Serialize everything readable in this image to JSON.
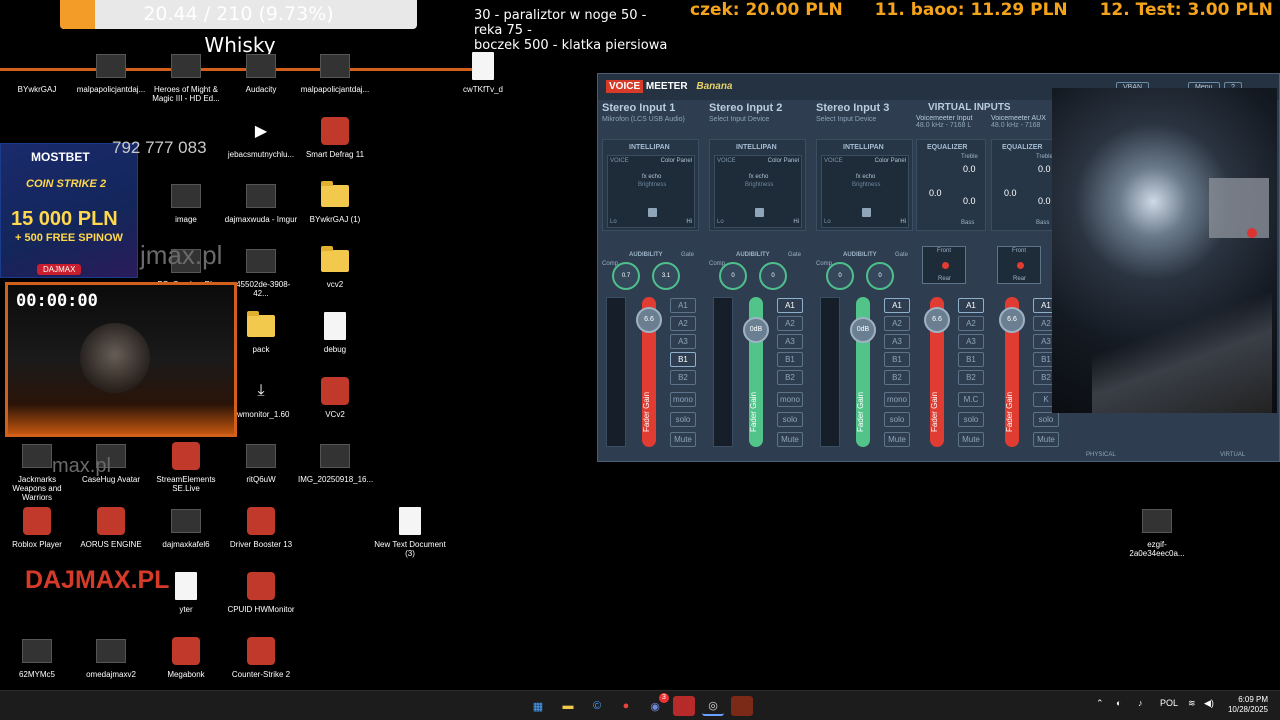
{
  "overlay": {
    "goal_text": "20.44 / 210 (9.73%)",
    "goal_fraction": 0.0973,
    "goal_name": "Whisky",
    "price_list": [
      "30 - paraliztor w noge 50 - reka 75 -",
      "boczek 500 - klatka piersiowa"
    ],
    "ticker": [
      {
        "rank": "",
        "name": "czek:",
        "amount": "20.00 PLN"
      },
      {
        "rank": "11.",
        "name": "baoo:",
        "amount": "11.29 PLN"
      },
      {
        "rank": "12.",
        "name": "Test:",
        "amount": "3.00 PLN"
      }
    ],
    "accent_color": "#f39c28",
    "line_color": "#d2601a"
  },
  "desktop": {
    "icons": [
      {
        "label": "BYwkrGAJ",
        "kind": "blank"
      },
      {
        "label": "malpapolicjantdaj...",
        "kind": "thumb"
      },
      {
        "label": "Heroes of Might & Magic III - HD Ed...",
        "kind": "thumb"
      },
      {
        "label": "Audacity",
        "kind": "thumb"
      },
      {
        "label": "malpapolicjantdaj...",
        "kind": "thumb"
      },
      {
        "label": "cwTKfTv_d",
        "kind": "doc"
      },
      {
        "label": "jebacsmutnychlu...",
        "kind": "media"
      },
      {
        "label": "Smart Defrag 11",
        "kind": "app"
      },
      {
        "label": "image",
        "kind": "thumb"
      },
      {
        "label": "dajmaxwuda - Imgur",
        "kind": "thumb"
      },
      {
        "label": "BYwkrGAJ (1)",
        "kind": "folder"
      },
      {
        "label": "BS_Overlay_PL",
        "kind": "thumb"
      },
      {
        "label": "a45502de-3908-42...",
        "kind": "thumb"
      },
      {
        "label": "vcv2",
        "kind": "folder"
      },
      {
        "label": "pack",
        "kind": "folder"
      },
      {
        "label": "debug",
        "kind": "doc"
      },
      {
        "label": "hwmonitor_1.60",
        "kind": "download"
      },
      {
        "label": "VCv2",
        "kind": "app"
      },
      {
        "label": "Jackmarks Weapons and Warriors",
        "kind": "thumb"
      },
      {
        "label": "CaseHug Avatar",
        "kind": "thumb"
      },
      {
        "label": "StreamElements SE.Live",
        "kind": "app"
      },
      {
        "label": "ritQ6uW",
        "kind": "thumb"
      },
      {
        "label": "IMG_20250918_16...",
        "kind": "thumb"
      },
      {
        "label": "Roblox Player",
        "kind": "app"
      },
      {
        "label": "AORUS ENGINE",
        "kind": "app"
      },
      {
        "label": "dajmaxkafel6",
        "kind": "thumb"
      },
      {
        "label": "Driver Booster 13",
        "kind": "app"
      },
      {
        "label": "New Text Document (3)",
        "kind": "doc"
      },
      {
        "label": "ezgif-2a0e34eec0a...",
        "kind": "thumb"
      },
      {
        "label": "yter",
        "kind": "doc"
      },
      {
        "label": "CPUID HWMonitor",
        "kind": "app"
      },
      {
        "label": "62MYMc5",
        "kind": "thumb"
      },
      {
        "label": "omedajmaxv2",
        "kind": "thumb"
      },
      {
        "label": "Megabonk",
        "kind": "app"
      },
      {
        "label": "Counter-Strike 2",
        "kind": "app"
      }
    ],
    "watermark_big": "DAJMAX.PL",
    "watermark_small_1": "jmax.pl",
    "watermark_small_2": "max.pl"
  },
  "ad": {
    "brand": "MOSTBET",
    "game": "COIN STRIKE 2",
    "amount": "15 000 PLN",
    "bonus": "+ 500 FREE SPINOW",
    "code": "DAJMAX",
    "phone": "792 777 083"
  },
  "webcam": {
    "timer": "00:00:00"
  },
  "voicemeeter": {
    "logo_voice": "VOICE",
    "logo_meeter": "MEETER",
    "logo_edition": "Banana",
    "vban_label": "VBAN",
    "menu_label": "Menu",
    "help_label": "?",
    "virtual_inputs_title": "VIRTUAL INPUTS",
    "strips": [
      {
        "name": "Stereo Input 1",
        "device": "Mikrofon (LCS USB Audio)",
        "section": "INTELLIPAN",
        "comp": "0.7",
        "gate": "3.1",
        "fader": "6.6",
        "fader_color": "red",
        "buses": [
          "A1",
          "A2",
          "A3",
          "B1",
          "B2"
        ],
        "active_buses": [
          "B1"
        ]
      },
      {
        "name": "Stereo Input 2",
        "device": "Select Input Device",
        "section": "INTELLIPAN",
        "comp": "0",
        "gate": "0",
        "fader": "0dB",
        "fader_color": "green",
        "buses": [
          "A1",
          "A2",
          "A3",
          "B1",
          "B2"
        ],
        "active_buses": [
          "A1"
        ]
      },
      {
        "name": "Stereo Input 3",
        "device": "Select Input Device",
        "section": "INTELLIPAN",
        "comp": "0",
        "gate": "0",
        "fader": "0dB",
        "fader_color": "green",
        "buses": [
          "A1",
          "A2",
          "A3",
          "B1",
          "B2"
        ],
        "active_buses": [
          "A1"
        ]
      }
    ],
    "virtual_strips": [
      {
        "name": "Voicemeeter Input",
        "freq": "48.0 kHz - 7168 L",
        "section": "EQUALIZER",
        "treble": "0.0",
        "bass": "0.0",
        "mid": "0.0",
        "fader": "6.6",
        "buses": [
          "A1",
          "A2",
          "A3",
          "B1",
          "B2"
        ],
        "active_buses": [
          "A1"
        ],
        "mc": "M.C"
      },
      {
        "name": "Voicemeeter AUX",
        "freq": "48.0 kHz - 7168",
        "section": "EQUALIZER",
        "treble": "0.0",
        "bass": "0.0",
        "mid": "0.0",
        "fader": "6.6",
        "buses": [
          "A1",
          "A2",
          "A3",
          "B1",
          "B2"
        ],
        "active_buses": [
          "A1"
        ],
        "mc": "K"
      }
    ],
    "labels": {
      "voice": "VOICE",
      "color_panel": "Color Panel",
      "fx_echo": "fx echo",
      "brightness": "Brightness",
      "lo": "Lo",
      "hi": "Hi",
      "comp": "Comp.",
      "audibility": "AUDIBILITY",
      "gate": "Gate",
      "mono": "mono",
      "solo": "solo",
      "mute": "Mute",
      "fader_gain": "Fader Gain",
      "treble": "Treble",
      "bass": "Bass",
      "front": "Front",
      "rear": "Rear",
      "physical": "PHYSICAL",
      "virtual": "VIRTUAL"
    }
  },
  "taskbar": {
    "language": "POL",
    "time": "6:09 PM",
    "date": "10/28/2025",
    "notification_badge": "3",
    "apps": [
      "start",
      "file-explorer",
      "ccleaner",
      "chrome",
      "discord",
      "streamlabs",
      "obs",
      "game"
    ]
  }
}
